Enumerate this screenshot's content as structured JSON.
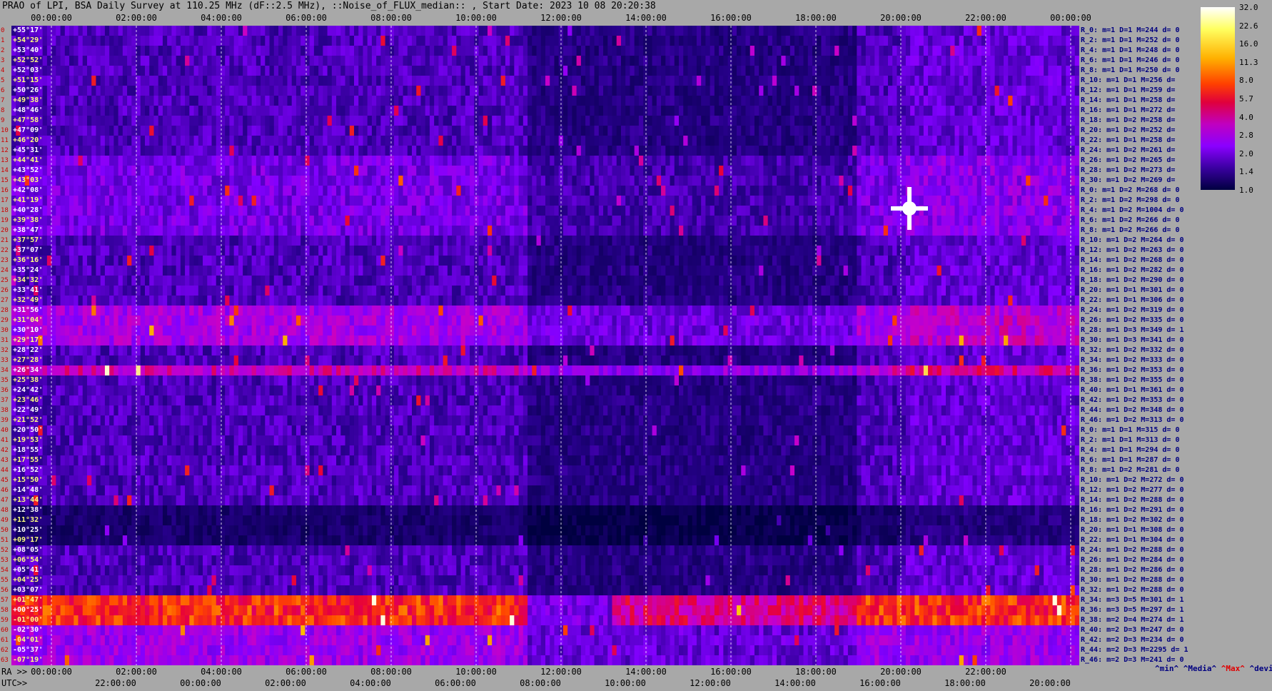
{
  "title": "PRAO of LPI, BSA Daily Survey at 110.25 MHz (dF::2.5 MHz), ::Noise_of_FLUX_median:: , Start Date: 2023 10 08 20:20:38",
  "top_axis_ticks": [
    "00:00:00",
    "02:00:00",
    "04:00:00",
    "06:00:00",
    "08:00:00",
    "10:00:00",
    "12:00:00",
    "14:00:00",
    "16:00:00",
    "18:00:00",
    "20:00:00",
    "22:00:00",
    "00:00:00"
  ],
  "bottom_ra_label": "RA >>",
  "bottom_ra_ticks": [
    "00:00:00",
    "02:00:00",
    "04:00:00",
    "06:00:00",
    "08:00:00",
    "10:00:00",
    "12:00:00",
    "14:00:00",
    "16:00:00",
    "18:00:00",
    "20:00:00",
    "22:00:00"
  ],
  "bottom_utc_label": "UTC>>",
  "bottom_utc_ticks": [
    "22:00:00",
    "00:00:00",
    "02:00:00",
    "04:00:00",
    "06:00:00",
    "08:00:00",
    "10:00:00",
    "12:00:00",
    "14:00:00",
    "16:00:00",
    "18:00:00",
    "20:00:00"
  ],
  "colorbar_ticks": [
    "32.0",
    "22.6",
    "16.0",
    "11.3",
    "8.0",
    "5.7",
    "4.0",
    "2.8",
    "2.0",
    "1.4",
    "1.0"
  ],
  "legend": {
    "min": "^min^",
    "media": "^Media^",
    "max": "^Max^",
    "devia": "^devia^"
  },
  "dec_labels": [
    "+55°17'",
    "+54°29'",
    "+53°40'",
    "+52°52'",
    "+52°03'",
    "+51°15'",
    "+50°26'",
    "+49°38'",
    "+48°46'",
    "+47°58'",
    "+47°09'",
    "+46°20'",
    "+45°31'",
    "+44°41'",
    "+43°52'",
    "+43°03'",
    "+42°08'",
    "+41°19'",
    "+40°28'",
    "+39°38'",
    "+38°47'",
    "+37°57'",
    "+37°07'",
    "+36°16'",
    "+35°24'",
    "+34°32'",
    "+33°41'",
    "+32°49'",
    "+31°56'",
    "+31°04'",
    "+30°10'",
    "+29°17'",
    "+28°22'",
    "+27°28'",
    "+26°34'",
    "+25°38'",
    "+24°42'",
    "+23°46'",
    "+22°49'",
    "+21°52'",
    "+20°50'",
    "+19°53'",
    "+18°55'",
    "+17°55'",
    "+16°52'",
    "+15°50'",
    "+14°48'",
    "+13°44'",
    "+12°38'",
    "+11°32'",
    "+10°25'",
    "+09°17'",
    "+08°05'",
    "+06°54'",
    "+05°41'",
    "+04°25'",
    "+03°07'",
    "+01°47'",
    "+00°25'",
    "-01°00'",
    "-02°30'",
    "-04°01'",
    "-05°37'",
    "-07°19'"
  ],
  "stats_rows": [
    "R_0: m=1 D=1 M=244 d= 0",
    "R_2: m=1 D=1 M=252 d= 0",
    "R_4: m=1 D=1 M=248 d= 0",
    "R_6: m=1 D=1 M=246 d= 0",
    "R_8: m=1 D=1 M=250 d= 0",
    "R_10: m=1 D=1 M=256 d=",
    "R_12: m=1 D=1 M=259 d=",
    "R_14: m=1 D=1 M=258 d=",
    "R_16: m=1 D=1 M=272 d=",
    "R_18: m=1 D=2 M=258 d=",
    "R_20: m=1 D=2 M=252 d=",
    "R_22: m=1 D=1 M=258 d=",
    "R_24: m=1 D=2 M=261 d=",
    "R_26: m=1 D=2 M=265 d=",
    "R_28: m=1 D=2 M=273 d=",
    "R_30: m=1 D=2 M=269 d=",
    "R_0: m=1 D=2 M=268 d= 0",
    "R_2: m=1 D=2 M=298 d= 0",
    "R_4: m=1 D=2 M=1004 d= 0",
    "R_6: m=1 D=2 M=266 d= 0",
    "R_8: m=1 D=2 M=266 d= 0",
    "R_10: m=1 D=2 M=264 d= 0",
    "R_12: m=1 D=2 M=263 d= 0",
    "R_14: m=1 D=2 M=268 d= 0",
    "R_16: m=1 D=2 M=282 d= 0",
    "R_18: m=1 D=2 M=290 d= 0",
    "R_20: m=1 D=1 M=301 d= 0",
    "R_22: m=1 D=1 M=306 d= 0",
    "R_24: m=1 D=2 M=319 d= 0",
    "R_26: m=1 D=2 M=335 d= 0",
    "R_28: m=1 D=3 M=349 d= 1",
    "R_30: m=1 D=3 M=341 d= 0",
    "R_32: m=1 D=2 M=332 d= 0",
    "R_34: m=1 D=2 M=333 d= 0",
    "R_36: m=1 D=2 M=353 d= 0",
    "R_38: m=1 D=2 M=355 d= 0",
    "R_40: m=1 D=1 M=361 d= 0",
    "R_42: m=1 D=2 M=353 d= 0",
    "R_44: m=1 D=2 M=348 d= 0",
    "R_46: m=1 D=2 M=313 d= 0",
    "R_0: m=1 D=1 M=315 d= 0",
    "R_2: m=1 D=1 M=313 d= 0",
    "R_4: m=1 D=1 M=294 d= 0",
    "R_6: m=1 D=1 M=287 d= 0",
    "R_8: m=1 D=2 M=281 d= 0",
    "R_10: m=1 D=2 M=272 d= 0",
    "R_12: m=1 D=2 M=277 d= 0",
    "R_14: m=1 D=2 M=288 d= 0",
    "R_16: m=1 D=2 M=291 d= 0",
    "R_18: m=1 D=2 M=302 d= 0",
    "R_20: m=1 D=1 M=308 d= 0",
    "R_22: m=1 D=1 M=304 d= 0",
    "R_24: m=1 D=2 M=288 d= 0",
    "R_26: m=1 D=2 M=284 d= 0",
    "R_28: m=1 D=2 M=286 d= 0",
    "R_30: m=1 D=2 M=288 d= 0",
    "R_32: m=1 D=2 M=288 d= 0",
    "R_34: m=3 D=5 M=301 d= 1",
    "R_36: m=3 D=5 M=297 d= 1",
    "R_38: m=2 D=4 M=274 d= 1",
    "R_40: m=2 D=3 M=247 d= 0",
    "R_42: m=2 D=3 M=234 d= 0",
    "R_44: m=2 D=3 M=2295 d= 1",
    "R_46: m=2 D=3 M=241 d= 0"
  ],
  "chart_data": {
    "type": "heatmap",
    "title": "PRAO of LPI, BSA Daily Survey at 110.25 MHz (dF::2.5 MHz), ::Noise_of_FLUX_median:: , Start Date: 2023 10 08 20:20:38",
    "x_axis_top": "00:00:00 to 00:00:00 (24 h)",
    "x_ticks": [
      "00:00:00",
      "02:00:00",
      "04:00:00",
      "06:00:00",
      "08:00:00",
      "10:00:00",
      "12:00:00",
      "14:00:00",
      "16:00:00",
      "18:00:00",
      "20:00:00",
      "22:00:00",
      "00:00:00"
    ],
    "y_ticks": "declination +55°17' to -07°19' (64 rows)",
    "colorscale": {
      "min": 1.0,
      "max": 32.0,
      "ticks": [
        32.0,
        22.6,
        16.0,
        11.3,
        8.0,
        5.7,
        4.0,
        2.8,
        2.0,
        1.4,
        1.0
      ],
      "scale": "log"
    },
    "bright_source": {
      "x_hour": 20.0,
      "dec": "+40°28'"
    },
    "strong_band_dec": "+01°47' to -01°00'",
    "colors": {
      "low": "#000040",
      "mid": "#8a00ff",
      "high": "#ff4000",
      "peak": "#ffffff"
    }
  }
}
